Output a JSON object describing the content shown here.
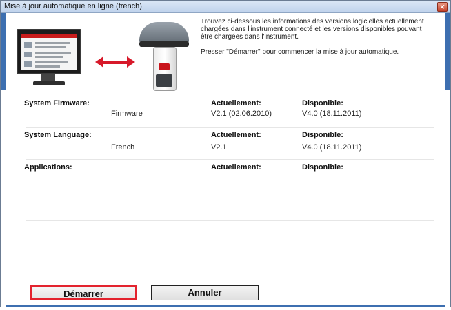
{
  "window": {
    "title": "Mise à jour automatique en ligne (french)",
    "close_symbol": "✕"
  },
  "info": {
    "paragraph1": "Trouvez ci-dessous les informations des versions logicielles actuellement chargées dans l'instrument connecté et les versions disponibles pouvant être chargées dans l'instrument.",
    "paragraph2": "Presser \"Démarrer\" pour commencer la mise à jour automatique."
  },
  "sections": [
    {
      "label": "System Firmware:",
      "current_header": "Actuellement:",
      "available_header": "Disponible:",
      "item": "Firmware",
      "current": "V2.1 (02.06.2010)",
      "available": "V4.0 (18.11.2011)"
    },
    {
      "label": "System Language:",
      "current_header": "Actuellement:",
      "available_header": "Disponible:",
      "item": "French",
      "current": "V2.1",
      "available": "V4.0 (18.11.2011)"
    },
    {
      "label": "Applications:",
      "current_header": "Actuellement:",
      "available_header": "Disponible:"
    }
  ],
  "buttons": {
    "start": "Démarrer",
    "cancel": "Annuler"
  },
  "colors": {
    "titlebar": "#c9d9ef",
    "frame": "#3d6fb0",
    "highlight": "#e3232e",
    "arrow": "#d7192a"
  },
  "icons": {
    "computer": "computer-monitor-icon",
    "arrow": "double-arrow-icon",
    "instrument": "gnss-receiver-icon"
  }
}
